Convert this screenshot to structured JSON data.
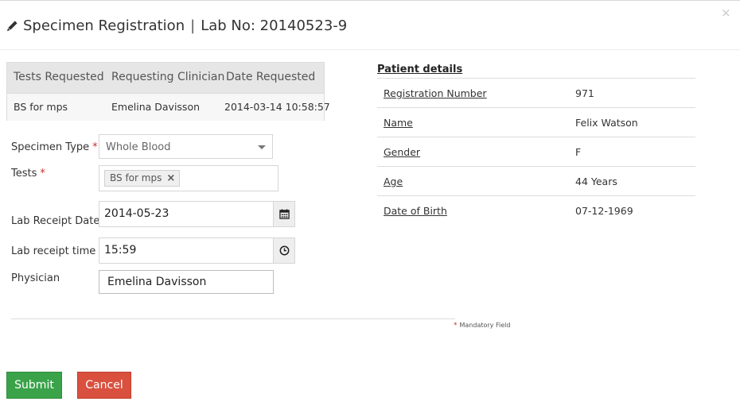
{
  "dialog": {
    "title": "Specimen Registration",
    "separator": "|",
    "lab_no": "Lab No: 20140523-9",
    "close": "×"
  },
  "request_table": {
    "headers": [
      "Tests Requested",
      "Requesting Clinician",
      "Date Requested"
    ],
    "rows": [
      [
        "BS for mps",
        "Emelina Davisson",
        "2014-03-14 10:58:57"
      ]
    ]
  },
  "form": {
    "required_mark": "*",
    "specimen_type": {
      "label": "Specimen Type",
      "value": "Whole Blood"
    },
    "tests": {
      "label": "Tests",
      "tags": [
        "BS for mps"
      ],
      "remove": "×"
    },
    "lab_receipt_date": {
      "label": "Lab Receipt Date",
      "value": "2014-05-23"
    },
    "lab_receipt_time": {
      "label": "Lab receipt time",
      "value": "15:59"
    },
    "physician": {
      "label": "Physician",
      "value": "Emelina Davisson"
    },
    "mandatory_note": "Mandatory Field"
  },
  "buttons": {
    "submit": "Submit",
    "cancel": "Cancel"
  },
  "patient_details": {
    "title": "Patient details",
    "rows": [
      {
        "label": "Registration Number",
        "value": "971"
      },
      {
        "label": "Name",
        "value": "Felix Watson"
      },
      {
        "label": "Gender",
        "value": "F"
      },
      {
        "label": "Age",
        "value": "44 Years"
      },
      {
        "label": "Date of Birth",
        "value": "07-12-1969"
      }
    ]
  },
  "colors": {
    "submit": "#3aa34a",
    "cancel": "#d9503f",
    "required": "#c9302c"
  },
  "icons": [
    "pencil-icon",
    "close-icon",
    "calendar-icon",
    "clock-icon",
    "caret-down-icon",
    "tag-remove-icon"
  ]
}
